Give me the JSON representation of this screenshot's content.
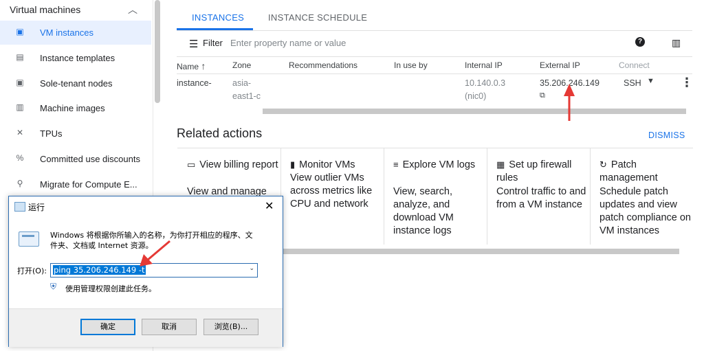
{
  "sidebar": {
    "section_title": "Virtual machines",
    "items": [
      {
        "label": "VM instances",
        "icon": "vm-instances-icon",
        "glyph": "▣",
        "active": true
      },
      {
        "label": "Instance templates",
        "icon": "instance-templates-icon",
        "glyph": "▤"
      },
      {
        "label": "Sole-tenant nodes",
        "icon": "sole-tenant-icon",
        "glyph": "▣"
      },
      {
        "label": "Machine images",
        "icon": "machine-images-icon",
        "glyph": "▥"
      },
      {
        "label": "TPUs",
        "icon": "tpu-icon",
        "glyph": "✕"
      },
      {
        "label": "Committed use discounts",
        "icon": "discount-icon",
        "glyph": "%"
      },
      {
        "label": "Migrate for Compute E...",
        "icon": "search-icon",
        "glyph": "⚲"
      }
    ]
  },
  "tabs": [
    {
      "label": "INSTANCES",
      "active": true
    },
    {
      "label": "INSTANCE SCHEDULE",
      "active": false
    }
  ],
  "filter": {
    "label": "Filter",
    "placeholder": "Enter property name or value"
  },
  "table": {
    "columns": [
      "Name",
      "Zone",
      "Recommendations",
      "In use by",
      "Internal IP",
      "External IP",
      "Connect"
    ],
    "row": {
      "name": "instance-",
      "zone_line1": "asia-",
      "zone_line2": "east1-c",
      "internal_ip_line1": "10.140.0.3",
      "internal_ip_line2": "(nic0)",
      "external_ip": "35.206.246.149",
      "connect": "SSH"
    }
  },
  "related": {
    "title": "Related actions",
    "dismiss": "DISMISS",
    "cards": [
      {
        "icon": "billing-icon",
        "glyph": "▭",
        "title": "View billing report",
        "desc": "View and manage"
      },
      {
        "icon": "monitor-icon",
        "glyph": "▮",
        "title": "Monitor VMs",
        "desc": "View outlier VMs across metrics like CPU and network"
      },
      {
        "icon": "logs-icon",
        "glyph": "≡",
        "title": "Explore VM logs",
        "desc": "View, search, analyze, and download VM instance logs"
      },
      {
        "icon": "firewall-icon",
        "glyph": "▦",
        "title": "Set up firewall rules",
        "desc": "Control traffic to and from a VM instance"
      },
      {
        "icon": "patch-icon",
        "glyph": "↻",
        "title": "Patch management",
        "desc": "Schedule patch updates and view patch compliance on VM instances"
      }
    ]
  },
  "run_dialog": {
    "title": "运行",
    "description": "Windows 将根据你所输入的名称，为你打开相应的程序、文件夹、文档或 Internet 资源。",
    "open_label": "打开(O):",
    "command": "ping 35.206.246.149 -t",
    "admin_note": "使用管理权限创建此任务。",
    "ok": "确定",
    "cancel": "取消",
    "browse": "浏览(B)..."
  },
  "colors": {
    "accent": "#1a73e8",
    "annotation_red": "#e53935"
  }
}
